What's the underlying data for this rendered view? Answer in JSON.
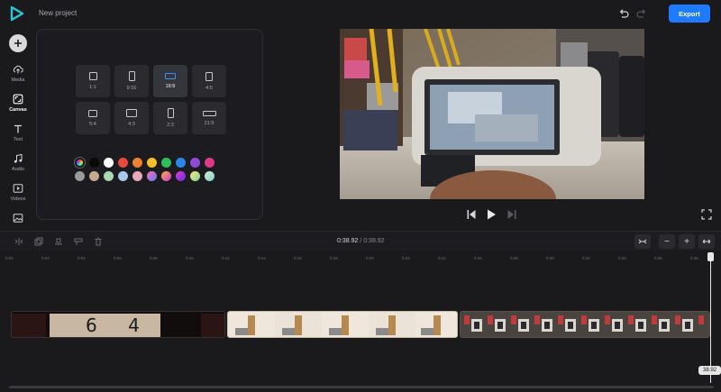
{
  "header": {
    "project_title": "New project",
    "export_label": "Export",
    "brand_color": "#1e7bff"
  },
  "sidebar": {
    "items": [
      {
        "label": "Media",
        "icon": "cloud-upload-icon"
      },
      {
        "label": "Canvas",
        "icon": "canvas-icon",
        "active": true
      },
      {
        "label": "Text",
        "icon": "text-icon"
      },
      {
        "label": "Audio",
        "icon": "music-note-icon"
      },
      {
        "label": "Videos",
        "icon": "video-icon"
      },
      {
        "label": "",
        "icon": "image-icon"
      }
    ]
  },
  "canvas_panel": {
    "ratios": [
      {
        "label": "1:1"
      },
      {
        "label": "9:16"
      },
      {
        "label": "16:9",
        "selected": true
      },
      {
        "label": "4:5"
      },
      {
        "label": "5:4"
      },
      {
        "label": "4:3"
      },
      {
        "label": "2:3"
      },
      {
        "label": "21:9"
      }
    ],
    "colors": [
      "rainbow",
      "#0a0a0a",
      "#ffffff",
      "#e84a3c",
      "#f0822f",
      "#f6c026",
      "#2fbf5a",
      "#2a86e8",
      "#8f4bd8",
      "#e0388a",
      "#9a9a9a",
      "#c4ab8e",
      "#a9d9b0",
      "#a8c8ee",
      "#e9a9b9",
      "gradient-pink-blue",
      "gradient-orange-purple",
      "gradient-purple",
      "gradient-green",
      "gradient-teal"
    ]
  },
  "timeline": {
    "current_time": "0:38.92",
    "separator": "/",
    "total_time": "0:38.92",
    "ruler_ticks": [
      "0:00",
      "0:02",
      "0:04",
      "0:06",
      "0:08",
      "0:10",
      "0:12",
      "0:14",
      "0:16",
      "0:18",
      "0:20",
      "0:22",
      "0:24",
      "0:26",
      "0:28",
      "0:30",
      "0:32",
      "0:34",
      "0:36",
      "0:38"
    ],
    "playhead_label": "38.92",
    "clip1_text": "6 4",
    "zoom_minus": "−",
    "zoom_plus": "+"
  }
}
